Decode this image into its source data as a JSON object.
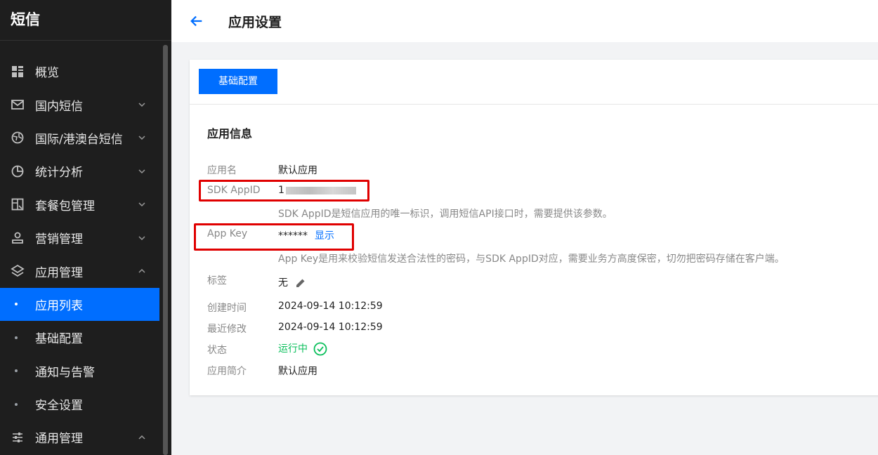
{
  "sidebar": {
    "title": "短信",
    "items": [
      {
        "label": "概览",
        "icon": "grid-icon",
        "chevron": ""
      },
      {
        "label": "国内短信",
        "icon": "mail-icon",
        "chevron": "down"
      },
      {
        "label": "国际/港澳台短信",
        "icon": "globe-icon",
        "chevron": "down"
      },
      {
        "label": "统计分析",
        "icon": "pie-chart-icon",
        "chevron": "down"
      },
      {
        "label": "套餐包管理",
        "icon": "package-icon",
        "chevron": "down"
      },
      {
        "label": "营销管理",
        "icon": "user-icon",
        "chevron": "down"
      },
      {
        "label": "应用管理",
        "icon": "layers-icon",
        "chevron": "up"
      }
    ],
    "subitems": [
      {
        "label": "应用列表",
        "active": true
      },
      {
        "label": "基础配置",
        "active": false
      },
      {
        "label": "通知与告警",
        "active": false
      },
      {
        "label": "安全设置",
        "active": false
      }
    ],
    "last": {
      "label": "通用管理",
      "icon": "sliders-icon",
      "chevron": "up"
    }
  },
  "header": {
    "title": "应用设置"
  },
  "tabs": {
    "basic": "基础配置"
  },
  "info": {
    "section_title": "应用信息",
    "app_name_label": "应用名",
    "app_name": "默认应用",
    "sdk_appid_label": "SDK AppID",
    "sdk_appid_prefix": "1",
    "sdk_appid_hint": "SDK AppID是短信应用的唯一标识，调用短信API接口时，需要提供该参数。",
    "app_key_label": "App Key",
    "app_key_masked": "******",
    "app_key_show": "显示",
    "app_key_hint": "App Key是用来校验短信发送合法性的密码，与SDK AppID对应，需要业务方高度保密，切勿把密码存储在客户端。",
    "tag_label": "标签",
    "tag_value": "无",
    "created_label": "创建时间",
    "created_value": "2024-09-14 10:12:59",
    "modified_label": "最近修改",
    "modified_value": "2024-09-14 10:12:59",
    "status_label": "状态",
    "status_value": "运行中",
    "intro_label": "应用简介",
    "intro_value": "默认应用"
  },
  "colors": {
    "accent": "#006eff",
    "success": "#0abf5b",
    "highlight": "#e00000",
    "sidebar_bg": "#1e1e1e"
  }
}
